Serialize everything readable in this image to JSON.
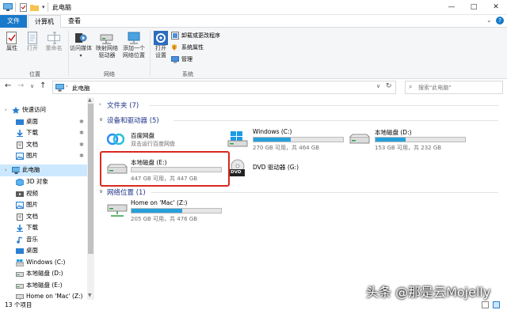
{
  "titlebar": {
    "title": "此电脑",
    "min": "—",
    "max": "□",
    "close": "✕"
  },
  "tabs": {
    "file": "文件",
    "computer": "计算机",
    "view": "查看"
  },
  "ribbon": {
    "properties": "属性",
    "open": "打开",
    "rename": "重命名",
    "group_location": "位置",
    "access_media": "访问媒体",
    "map_drive_1": "映射网络",
    "map_drive_2": "驱动器",
    "add_net_1": "添加一个",
    "add_net_2": "网络位置",
    "group_network": "网络",
    "open_settings_1": "打开",
    "open_settings_2": "设置",
    "uninstall": "卸载或更改程序",
    "sys_props": "系统属性",
    "manage": "管理",
    "group_system": "系统"
  },
  "address": {
    "path": "此电脑",
    "search_placeholder": "搜索\"此电脑\""
  },
  "nav": {
    "items": [
      "快速访问",
      "桌面",
      "下载",
      "文档",
      "图片",
      "此电脑",
      "3D 对象",
      "视频",
      "图片",
      "文档",
      "下载",
      "音乐",
      "桌面",
      "Windows (C:)",
      "本地磁盘 (D:)",
      "本地磁盘 (E:)",
      "Home on 'Mac' (Z:)"
    ]
  },
  "sections": {
    "folders": "文件夹 (7)",
    "devices": "设备和驱动器 (5)",
    "network": "网络位置 (1)"
  },
  "drives": {
    "baidu": {
      "name": "百度网盘",
      "sub": "双击运行百度网盘"
    },
    "c": {
      "name": "Windows (C:)",
      "sub": "270 GB 可用，共 464 GB",
      "used": 0.42
    },
    "d": {
      "name": "本地磁盘 (D:)",
      "sub": "153 GB 可用，共 232 GB",
      "used": 0.34
    },
    "e": {
      "name": "本地磁盘 (E:)",
      "sub": "447 GB 可用，共 447 GB",
      "used": 0.0
    },
    "dvd": {
      "name": "DVD 驱动器 (G:)",
      "badge": "DVD"
    },
    "z": {
      "name": "Home on 'Mac' (Z:)",
      "sub": "205 GB 可用，共 476 GB",
      "used": 0.57
    }
  },
  "status": {
    "count": "13 个项目"
  },
  "watermark": "头条 @那是云Mojelly",
  "colors": {
    "accent": "#1979ca",
    "bar": "#26a0da",
    "highlight": "#d9291c"
  }
}
